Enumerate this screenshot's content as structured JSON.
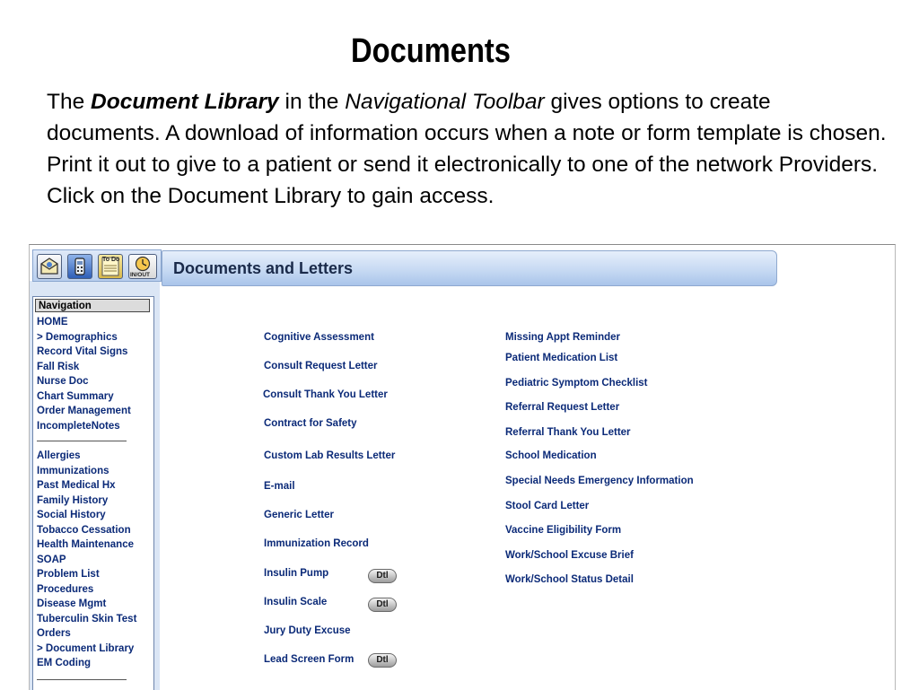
{
  "slide": {
    "title": "Documents",
    "intro": {
      "p1": "The ",
      "p2": "Document Library",
      "p3": "  in the ",
      "p4": "Navigational Toolbar",
      "p5": " gives options to create documents.  A download of information occurs when a note or form template is chosen.  Print it out to give to a patient or send it electronically to one of the network Providers. Click on the Document Library to gain access."
    }
  },
  "toolbar": {
    "icons": [
      "envelope-icon",
      "phone-icon",
      "todo-notepad-icon",
      "in-out-clock-icon"
    ],
    "todo_label": "To Do",
    "inout_label": "IN/OUT"
  },
  "header": {
    "title": "Documents and Letters"
  },
  "nav": {
    "heading": "Navigation",
    "items_group1": [
      "HOME",
      "> Demographics",
      "Record Vital Signs",
      "Fall Risk",
      "Nurse Doc",
      "Chart Summary",
      "Order Management",
      "IncompleteNotes"
    ],
    "items_group2": [
      "Allergies",
      "Immunizations",
      "Past Medical Hx",
      "Family History",
      "Social History",
      "Tobacco Cessation",
      "Health Maintenance",
      "SOAP",
      "Problem List",
      "Procedures",
      "Disease Mgmt",
      "Tuberculin Skin Test",
      "Orders",
      "> Document Library",
      "EM Coding"
    ]
  },
  "documents": {
    "left": [
      {
        "label": "Cognitive Assessment",
        "dtl": false
      },
      {
        "label": "Consult Request Letter",
        "dtl": false
      },
      {
        "label": "Consult Thank You Letter",
        "dtl": false
      },
      {
        "label": "Contract for Safety",
        "dtl": false
      },
      {
        "label": "Custom Lab Results Letter",
        "dtl": false
      },
      {
        "label": "E-mail",
        "dtl": false
      },
      {
        "label": "Generic Letter",
        "dtl": false
      },
      {
        "label": "Immunization Record",
        "dtl": false
      },
      {
        "label": "Insulin Pump",
        "dtl": true
      },
      {
        "label": "Insulin Scale",
        "dtl": true
      },
      {
        "label": "Jury Duty Excuse",
        "dtl": false
      },
      {
        "label": "Lead Screen Form",
        "dtl": true
      }
    ],
    "right": [
      "Missing Appt Reminder",
      "Patient Medication List",
      "Pediatric Symptom Checklist",
      "Referral Request Letter",
      "Referral Thank You Letter",
      "School Medication",
      "Special Needs Emergency Information",
      "Stool Card Letter",
      "Vaccine Eligibility Form",
      "Work/School Excuse Brief",
      "Work/School Status Detail"
    ],
    "dtl_label": "Dtl"
  }
}
